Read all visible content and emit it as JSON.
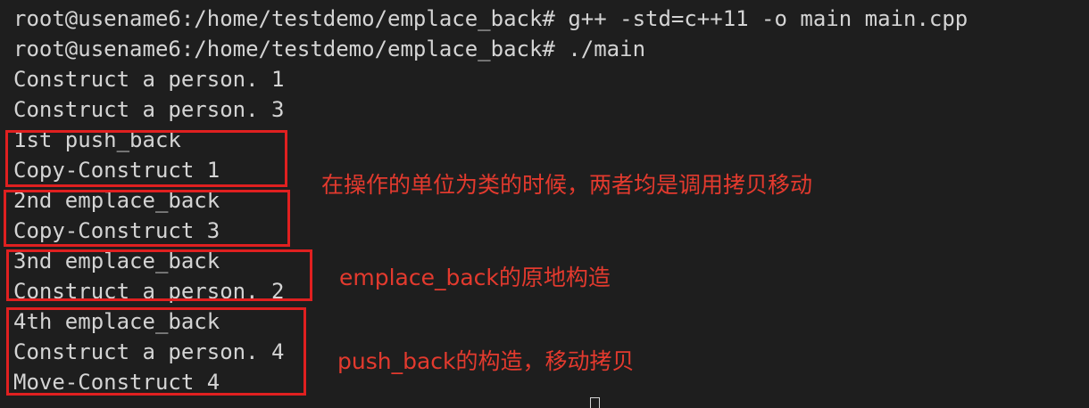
{
  "terminal": {
    "lines": [
      "root@usename6:/home/testdemo/emplace_back# g++ -std=c++11 -o main main.cpp",
      "root@usename6:/home/testdemo/emplace_back# ./main",
      "Construct a person. 1",
      "Construct a person. 3",
      "1st push_back",
      "Copy-Construct 1",
      "2nd emplace_back",
      "Copy-Construct 3",
      "3nd emplace_back",
      "Construct a person. 2",
      "4th emplace_back",
      "Construct a person. 4",
      "Move-Construct 4"
    ]
  },
  "annotations": {
    "note1": "在操作的单位为类的时候，两者均是调用拷贝移动",
    "note2": "emplace_back的原地构造",
    "note3": "push_back的构造，移动拷贝"
  },
  "colors": {
    "background": "#1e1e1e",
    "text": "#d4d4d4",
    "annotation": "#e33a2e",
    "box": "#e02020"
  }
}
